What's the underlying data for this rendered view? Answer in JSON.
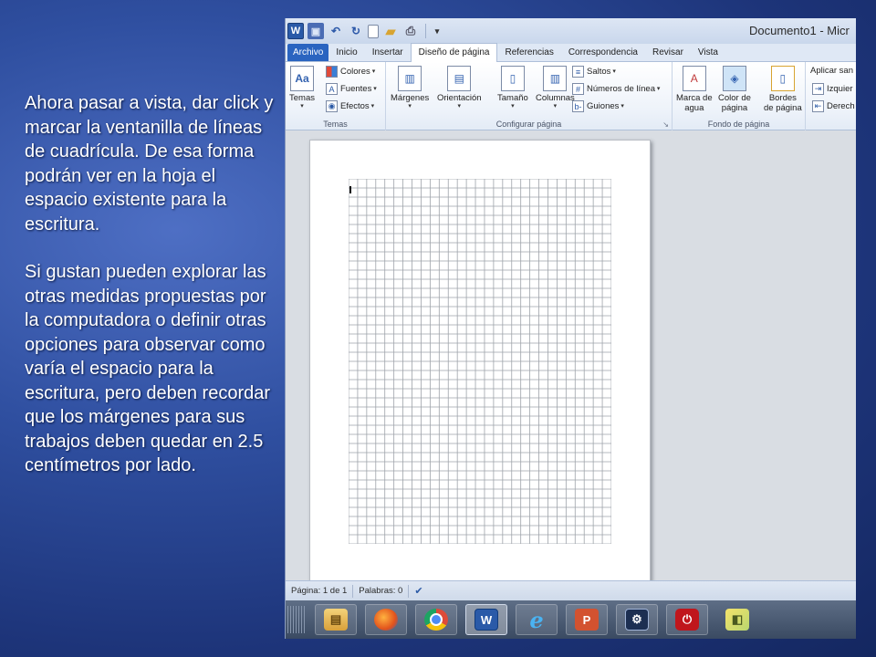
{
  "slide": {
    "paragraph1": "Ahora pasar a vista, dar click y marcar la ventanilla de líneas de cuadrícula. De esa forma podrán ver en la hoja el espacio existente para la escritura.",
    "paragraph2": "Si gustan pueden explorar las otras medidas propuestas por la computadora o definir otras opciones para observar como varía el espacio para la escritura, pero deben recordar que los márgenes para sus trabajos deben quedar en 2.5 centímetros por lado."
  },
  "window": {
    "title": "Documento1 - Micr",
    "qat_word": "W",
    "qat_save": "▣",
    "qat_undo": "↶",
    "qat_redo": "↻",
    "qat_open": "▰",
    "qat_print": "⎙",
    "qat_customize": "▾"
  },
  "tabs": [
    {
      "label": "Archivo"
    },
    {
      "label": "Inicio"
    },
    {
      "label": "Insertar"
    },
    {
      "label": "Diseño de página"
    },
    {
      "label": "Referencias"
    },
    {
      "label": "Correspondencia"
    },
    {
      "label": "Revisar"
    },
    {
      "label": "Vista"
    }
  ],
  "ribbon": {
    "temas": {
      "label": "Temas",
      "temas_button": "Temas",
      "colores": "Colores",
      "fuentes": "Fuentes",
      "efectos": "Efectos"
    },
    "configurar": {
      "label": "Configurar página",
      "margenes": "Márgenes",
      "orientacion": "Orientación",
      "tamano": "Tamaño",
      "columnas": "Columnas",
      "saltos": "Saltos",
      "numeros": "Números de línea",
      "guiones": "Guiones"
    },
    "fondo": {
      "label": "Fondo de página",
      "marca_line1": "Marca de",
      "marca_line2": "agua",
      "color_line1": "Color de",
      "color_line2": "página",
      "bordes_line1": "Bordes",
      "bordes_line2": "de página"
    },
    "parrafo": {
      "aplicar": "Aplicar san",
      "izquierda": "Izquier",
      "derecha": "Derech"
    }
  },
  "statusbar": {
    "pagina": "Página: 1 de 1",
    "palabras": "Palabras: 0"
  },
  "grid": {
    "columns": 29,
    "rows": 40
  },
  "taskbar": {
    "word_glyph": "W",
    "ie_glyph": "e",
    "ppt_glyph": "P",
    "power_glyph": "⏻"
  }
}
